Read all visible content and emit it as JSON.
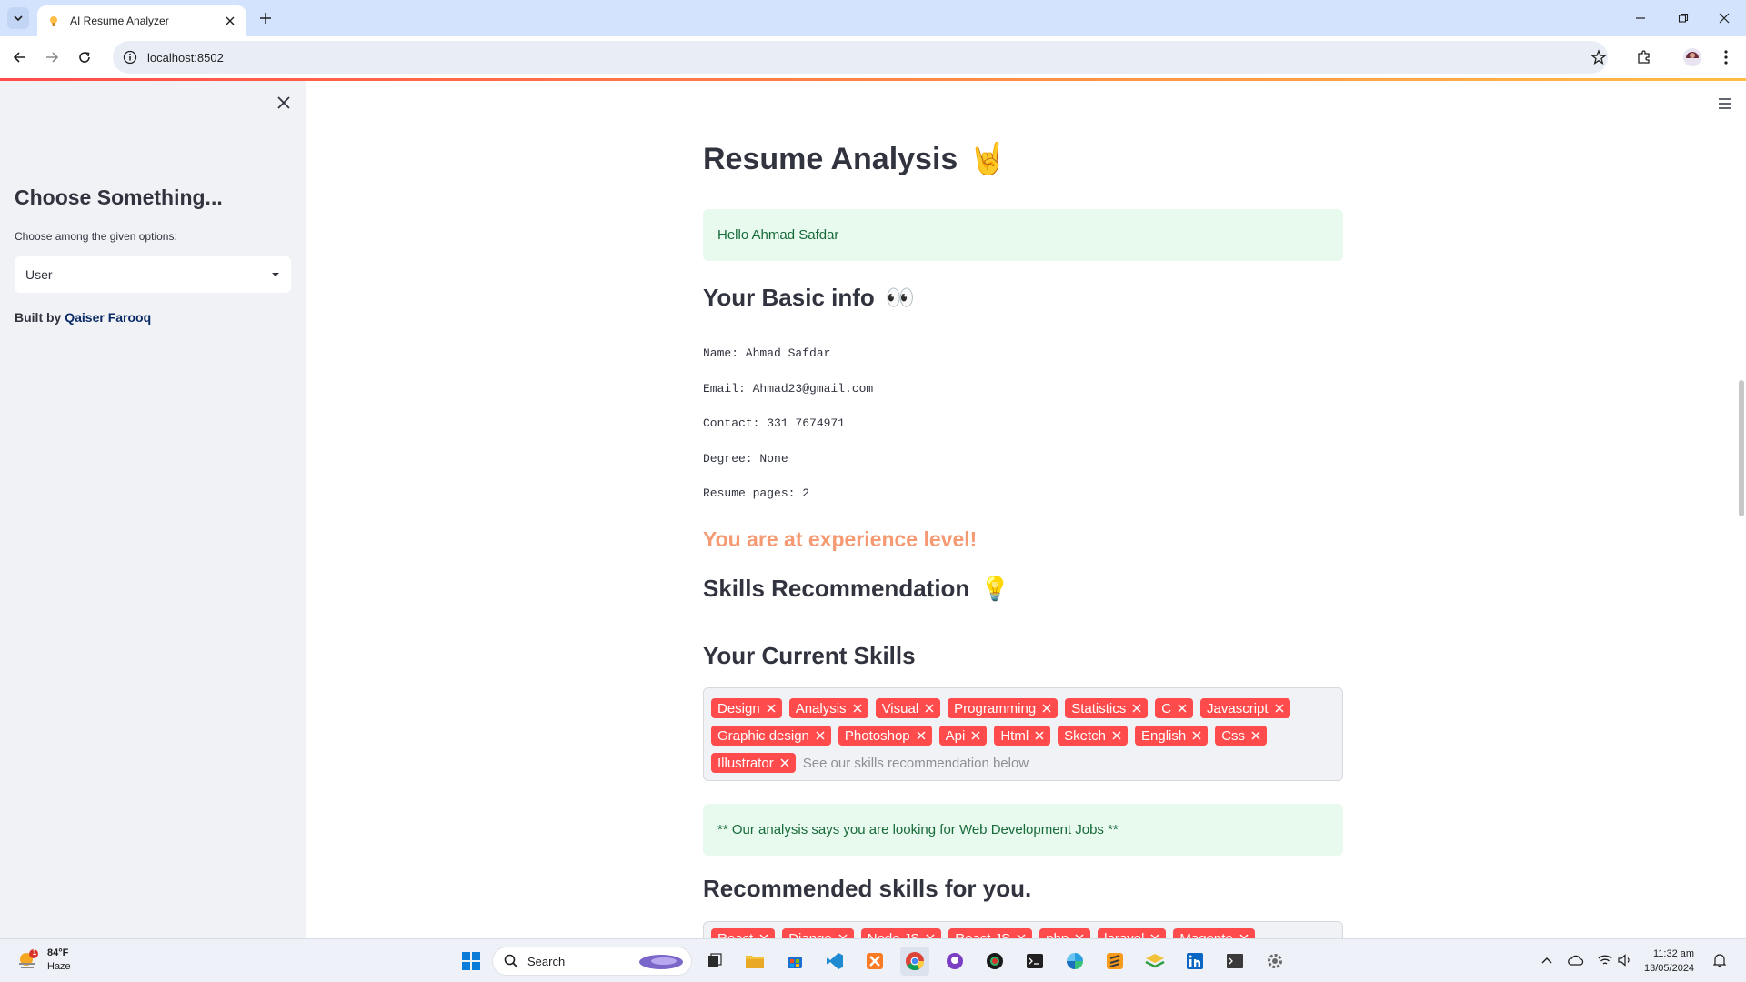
{
  "browser": {
    "tab_title": "AI Resume Analyzer",
    "url": "localhost:8502"
  },
  "sidebar": {
    "title": "Choose Something...",
    "select_label": "Choose among the given options:",
    "select_value": "User",
    "built_prefix": "Built by ",
    "built_author": "Qaiser Farooq"
  },
  "main": {
    "title": "Resume Analysis",
    "title_emoji": "🤘",
    "greeting": "Hello Ahmad Safdar",
    "basic_info_heading": "Your Basic info",
    "basic_info_emoji": "👀",
    "info_lines": [
      "Name: Ahmad Safdar",
      "Email: Ahmad23@gmail.com",
      "Contact: 331 7674971",
      "Degree: None",
      "Resume pages: 2"
    ],
    "experience_level": "You are at experience level!",
    "skills_rec_heading": "Skills Recommendation",
    "skills_rec_emoji": "💡",
    "current_skills_heading": "Your Current Skills",
    "current_skills": [
      "Design",
      "Analysis",
      "Visual",
      "Programming",
      "Statistics",
      "C",
      "Javascript",
      "Graphic design",
      "Photoshop",
      "Api",
      "Html",
      "Sketch",
      "English",
      "Css",
      "Illustrator"
    ],
    "skills_placeholder": "See our skills recommendation below",
    "analysis_msg": "** Our analysis says you are looking for Web Development Jobs **",
    "recommended_heading": "Recommended skills for you.",
    "recommended_skills": [
      "React",
      "Django",
      "Node JS",
      "React JS",
      "php",
      "laravel",
      "Magento"
    ]
  },
  "taskbar": {
    "weather_temp": "84°F",
    "weather_desc": "Haze",
    "weather_badge": "1",
    "search_label": "Search",
    "time": "11:32 am",
    "date": "13/05/2024"
  },
  "colors": {
    "accent": "#ff4b4b",
    "success_bg": "#e8f9ee",
    "success_text": "#176b3a",
    "experience": "#f59a73",
    "sidebar_bg": "#f0f2f6"
  }
}
